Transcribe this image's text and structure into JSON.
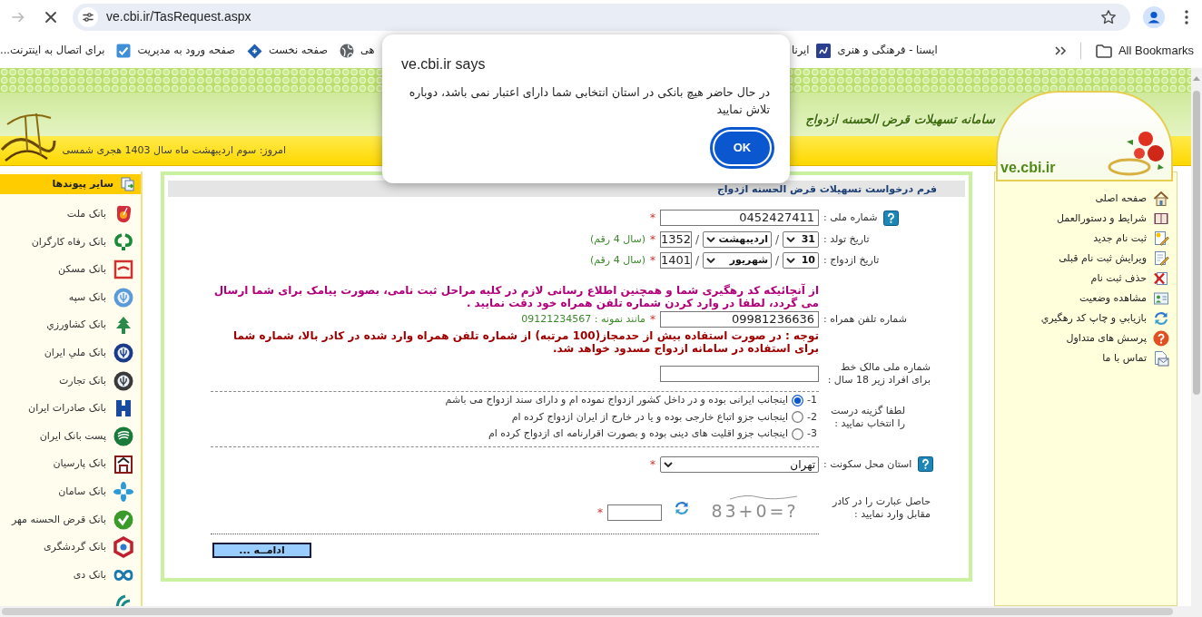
{
  "browser": {
    "forward_disabled": true,
    "loading": true,
    "address": "ve.cbi.ir/TasRequest.aspx",
    "bookmarks": [
      {
        "kind": "tile",
        "label": "ایسنا - فرهنگی و هنری"
      },
      {
        "kind": "plain",
        "label": "ایرنا"
      },
      {
        "kind": "globe",
        "label": "هی"
      },
      {
        "kind": "diamond",
        "label": "صفحه نخست"
      },
      {
        "kind": "check",
        "label": "صفحه ورود به مدیریت"
      },
      {
        "kind": "plain",
        "label": "برای اتصال به اینترنت..."
      }
    ],
    "all_bookmarks": "All Bookmarks"
  },
  "dialog": {
    "title": "ve.cbi.ir says",
    "message": "در حال حاضر هیچ بانکی در استان انتخابی شما دارای اعتبار نمی باشد، دوباره تلاش نمایید",
    "button": "OK"
  },
  "banner": {
    "title": "سامانه تسهیلات قرض الحسنه ازدواج",
    "date": "امروز: سوم اردیبهشت ماه سال 1403 هجری شمسی",
    "logo_text": "ve.cbi.ir"
  },
  "links_sidebar": {
    "title": "سایر پیوندها",
    "items": [
      {
        "kind": "shield",
        "color": "#d32f3a",
        "label": "بانک ملت"
      },
      {
        "kind": "hooks",
        "color": "#1a8a3a",
        "label": "بانک رفاه کارگران"
      },
      {
        "kind": "frame",
        "color": "#d03030",
        "label": "بانک مسکن"
      },
      {
        "kind": "crest",
        "color": "#5a9ad8",
        "label": "بانک سپه"
      },
      {
        "kind": "tree",
        "color": "#2a8a4a",
        "label": "بانک کشاورزي"
      },
      {
        "kind": "crest",
        "color": "#1a3a8a",
        "label": "بانک ملي ايران"
      },
      {
        "kind": "crest",
        "color": "#3a3a3a",
        "label": "بانک تجارت"
      },
      {
        "kind": "hblock",
        "color": "#1a4aa0",
        "label": "بانک صادرات ايران"
      },
      {
        "kind": "swoosh",
        "color": "#1a7a3a",
        "label": "پست بانک ايران"
      },
      {
        "kind": "gate",
        "color": "#8a1a1a",
        "label": "بانک پارسيان"
      },
      {
        "kind": "flower",
        "color": "#2a9ad8",
        "label": "بانک سامان"
      },
      {
        "kind": "check",
        "color": "#3a9a2a",
        "label": "بانک قرض الحسنه مهر"
      },
      {
        "kind": "hexring",
        "color": "#c02030",
        "label": "بانک گردشگری"
      },
      {
        "kind": "infinity",
        "color": "#1a7ab0",
        "label": "بانک دی"
      },
      {
        "kind": "arc",
        "color": "#1a8a8a"
      }
    ]
  },
  "form": {
    "title": "فرم درخواست تسهیلات قرض الحسنه ازدواج",
    "rows": [
      {
        "kind": "text",
        "help": true,
        "label": "شماره ملی :",
        "value": "0452427411",
        "mark": "*"
      },
      {
        "kind": "date",
        "help": false,
        "label": "تاریخ تولد :",
        "day": "31",
        "month": "اردیبهشت",
        "year": "1352",
        "separators": [
          "/",
          "/"
        ],
        "mark": "*",
        "hint": "(سال 4 رقم)"
      },
      {
        "kind": "date",
        "help": false,
        "label": "تاریخ ازدواج :",
        "day": "10",
        "month": "شهریور",
        "year": "1401",
        "separators": [
          "/",
          "/"
        ],
        "mark": "*",
        "hint": "(سال 4 رقم)"
      },
      {
        "kind": "notice",
        "text": "از آنجائیکه کد رهگیری شما و همچنین اطلاع رسانی لازم در کلیه مراحل ثبت نامی، بصورت پیامک برای شما ارسال می گردد، لطفا در وارد کردن شماره تلفن همراه خود دقت نمایید ."
      },
      {
        "kind": "text",
        "help": false,
        "label": "شماره تلفن همراه :",
        "value": "09981236636",
        "mark": "*",
        "hint": "مانند نمونه : 09121234567"
      },
      {
        "kind": "warning",
        "text": "توجه : در صورت استفاده بیش از حدمجاز(100 مرتبه) از شماره تلفن همراه وارد شده در کادر بالا، شماره شما برای استفاده در سامانه ازدواج مسدود خواهد شد."
      },
      {
        "kind": "text",
        "help": false,
        "label": "شماره ملی مالک خط برای افراد زیر 18 سال :"
      },
      {
        "kind": "radio",
        "help": false,
        "label": "لطفا گزینه درست را انتخاب نمایید :",
        "options": [
          {
            "number": "-1",
            "text": "اینجانب ایرانی بوده و در داخل کشور ازدواج نموده ام و دارای سند ازدواج می باشم",
            "selected": true
          },
          {
            "number": "-2",
            "text": "اینجانب جزو اتباع خارجی بوده و یا در خارج از ایران ازدواج کرده ام",
            "selected": false
          },
          {
            "number": "-3",
            "text": "اینجانب جزو اقلیت های دینی بوده و بصورت اقرارنامه ای ازدواج کرده ام",
            "selected": false
          }
        ]
      },
      {
        "kind": "select",
        "help": true,
        "label": "استان محل سکونت :",
        "value": "تهران",
        "mark": "*"
      },
      {
        "kind": "captcha",
        "help": false,
        "label": "حاصل عبارت را در کادر مقابل وارد نمایید :",
        "captcha": "83+0=?",
        "mark": "*"
      }
    ],
    "submit": "ادامــه ..."
  },
  "menu": {
    "items": [
      {
        "kind": "house",
        "label": "صفحه اصلی"
      },
      {
        "kind": "book",
        "label": "شرایط و دستورالعمل"
      },
      {
        "kind": "new",
        "label": "ثبت نام جدید"
      },
      {
        "kind": "edit",
        "label": "ویرایش ثبت نام قبلی"
      },
      {
        "kind": "delete",
        "label": "حذف ثبت نام"
      },
      {
        "kind": "status",
        "label": "مشاهده وضعیت"
      },
      {
        "kind": "recover",
        "label": "بازیابي و چاپ کد رهگیري"
      },
      {
        "kind": "faq",
        "label": "پرسش های متداول"
      },
      {
        "kind": "contact",
        "label": "تماس با ما"
      }
    ]
  }
}
